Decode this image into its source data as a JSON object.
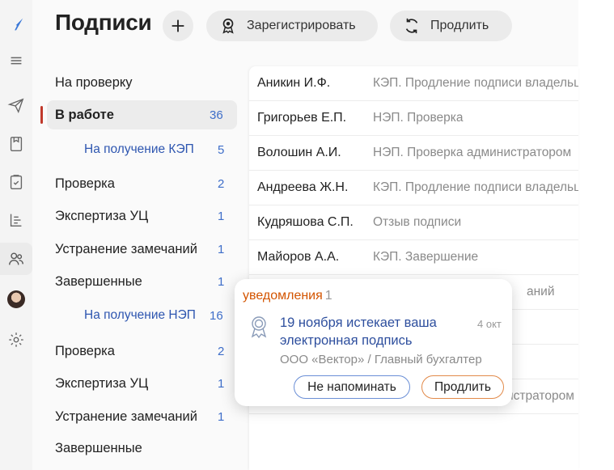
{
  "app": {
    "title": "Подписи"
  },
  "toolbar": {
    "register_label": "Зарегистрировать",
    "renew_label": "Продлить"
  },
  "nav": {
    "items": [
      {
        "label": "На проверку",
        "count": ""
      },
      {
        "label": "В работе",
        "count": "36"
      },
      {
        "label": "На получение КЭП",
        "count": "5"
      },
      {
        "label": "Проверка",
        "count": "2"
      },
      {
        "label": "Экспертиза УЦ",
        "count": "1"
      },
      {
        "label": "Устранение замечаний",
        "count": "1"
      },
      {
        "label": "Завершенные",
        "count": "1"
      },
      {
        "label": "На получение НЭП",
        "count": "16"
      },
      {
        "label": "Проверка",
        "count": "2"
      },
      {
        "label": "Экспертиза УЦ",
        "count": "1"
      },
      {
        "label": "Устранение замечаний",
        "count": "1"
      },
      {
        "label": "Завершенные",
        "count": ""
      }
    ]
  },
  "list": {
    "rows": [
      {
        "name": "Аникин И.Ф.",
        "desc": "КЭП. Продление подписи владельца"
      },
      {
        "name": "Григорьев Е.П.",
        "desc": "НЭП. Проверка"
      },
      {
        "name": "Волошин А.И.",
        "desc": "НЭП. Проверка администратором"
      },
      {
        "name": "Андреева Ж.Н.",
        "desc": "КЭП. Продление подписи владельца"
      },
      {
        "name": "Кудряшова С.П.",
        "desc": "Отзыв подписи"
      },
      {
        "name": "Майоров А.А.",
        "desc": "КЭП. Завершение"
      },
      {
        "name": "",
        "desc": "аний"
      },
      {
        "name": "",
        "desc": ""
      },
      {
        "name": "",
        "desc": ""
      },
      {
        "name": "",
        "desc": "истратором"
      }
    ]
  },
  "notification": {
    "heading": "уведомления",
    "count": "1",
    "title": "19 ноября истекает ваша электронная подпись",
    "date": "4 окт",
    "org": "ООО «Вектор» / Главный бухгалтер",
    "dismiss_label": "Не напоминать",
    "renew_label": "Продлить"
  },
  "icons": {
    "logo": "logo-icon",
    "menu": "hamburger-icon",
    "send": "paper-plane-icon",
    "archive": "archive-icon",
    "tasks": "clipboard-check-icon",
    "structure": "org-structure-icon",
    "users": "users-icon",
    "avatar": "user-avatar",
    "settings": "gear-icon",
    "add": "plus-icon",
    "register": "badge-icon",
    "renew": "refresh-icon",
    "certificate": "certificate-icon"
  },
  "colors": {
    "accent_blue": "#2e56b0",
    "count_blue": "#3e6ec9",
    "active_bar": "#c0392b",
    "notification_orange": "#d35400",
    "renew_border": "#e28a4a",
    "dismiss_border": "#6b8fd6"
  }
}
